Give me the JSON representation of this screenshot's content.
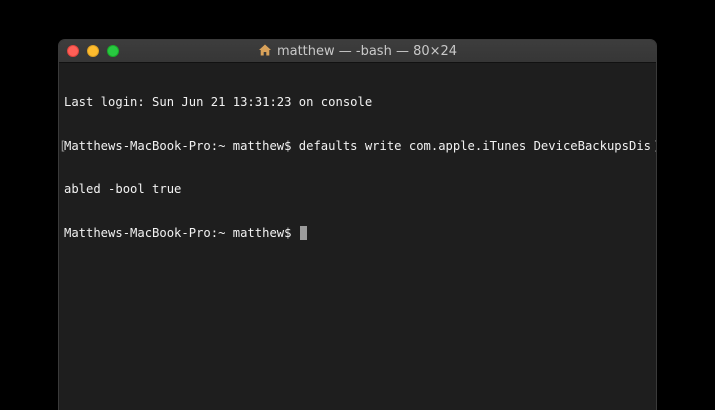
{
  "window": {
    "title": "matthew — -bash — 80×24",
    "title_icon": "home-folder-icon"
  },
  "terminal": {
    "lines": [
      "Last login: Sun Jun 21 13:31:23 on console",
      "Matthews-MacBook-Pro:~ matthew$ defaults write com.apple.iTunes DeviceBackupsDis",
      "abled -bool true",
      "Matthews-MacBook-Pro:~ matthew$ "
    ],
    "mark_left": "[",
    "mark_right": "]"
  },
  "colors": {
    "background": "#1e1e1e",
    "text": "#f2f2f2",
    "cursor": "#9b9b9b",
    "close": "#ff5f57",
    "minimize": "#febc2e",
    "zoom": "#28c840"
  }
}
